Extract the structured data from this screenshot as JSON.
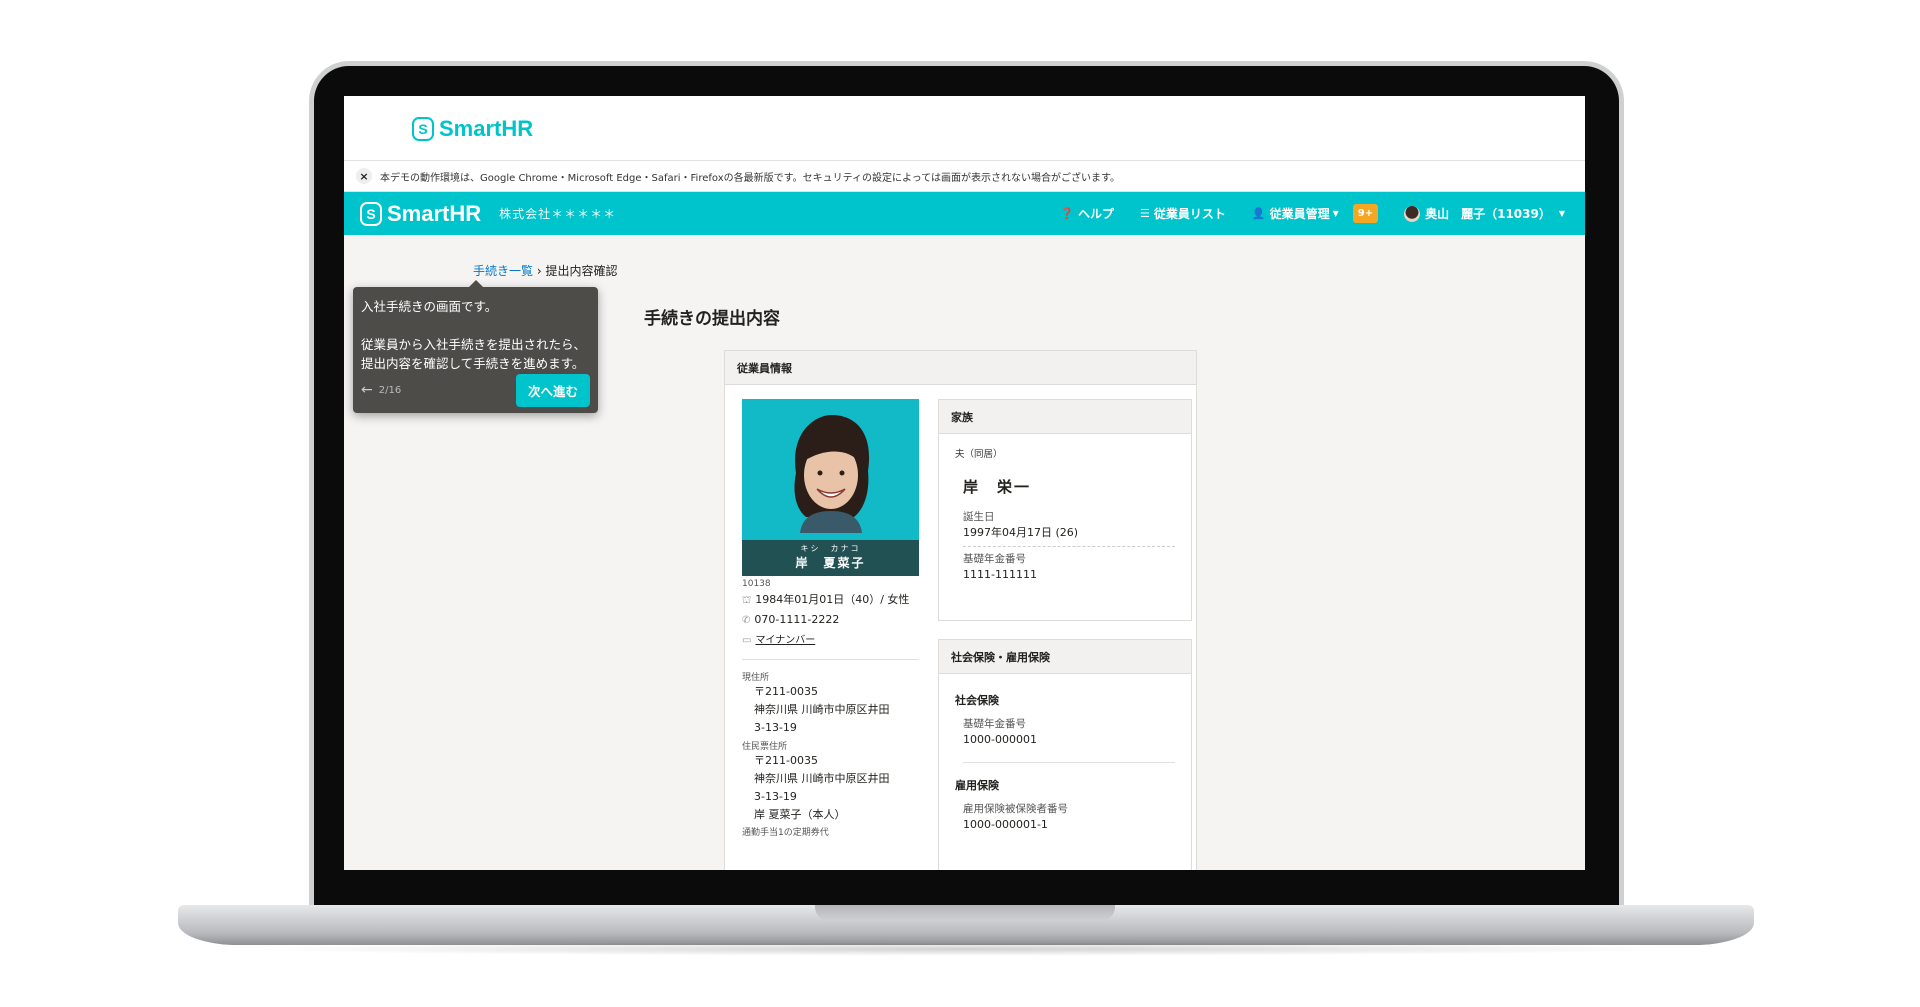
{
  "brand": {
    "name": "SmartHR",
    "mark": "S"
  },
  "notice": {
    "text": "本デモの動作環境は、Google Chrome・Microsoft Edge・Safari・Firefoxの各最新版です。セキュリティの設定によっては画面が表示されない場合がございます。"
  },
  "nav": {
    "company": "株式会社＊＊＊＊＊",
    "help": "ヘルプ",
    "employee_list": "従業員リスト",
    "employee_manage": "従業員管理",
    "badge": "9+",
    "user": "奥山　麗子（11039）"
  },
  "breadcrumb": {
    "link": "手続き一覧",
    "sep": "›",
    "current": "提出内容確認"
  },
  "page_title": "手続きの提出内容",
  "tooltip": {
    "line1": "入社手続きの画面です。",
    "line2": "従業員から入社手続きを提出されたら、提出内容を確認して手続きを進めます。",
    "step": "2/16",
    "next": "次へ進む"
  },
  "employee": {
    "section_title": "従業員情報",
    "kana": "キシ　カナコ",
    "name": "岸　夏菜子",
    "id": "10138",
    "birth": "1984年01月01日（40）/ 女性",
    "phone": "070-1111-2222",
    "mynumber": "マイナンバー",
    "address_label": "現住所",
    "address_zip": "〒211-0035",
    "address_line1": "神奈川県 川崎市中原区井田",
    "address_line2": "3-13-19",
    "resident_label": "住民票住所",
    "resident_zip": "〒211-0035",
    "resident_line1": "神奈川県 川崎市中原区井田",
    "resident_line2": "3-13-19",
    "resident_holder": "岸 夏菜子（本人）",
    "commute": "通勤手当1の定期券代"
  },
  "family": {
    "title": "家族",
    "relation": "夫（同居）",
    "name": "岸　栄一",
    "birth_label": "誕生日",
    "birth_value": "1997年04月17日 (26)",
    "pension_label": "基礎年金番号",
    "pension_value": "1111-111111"
  },
  "insurance": {
    "title": "社会保険・雇用保険",
    "social_title": "社会保険",
    "pension_label": "基礎年金番号",
    "pension_value": "1000-000001",
    "employment_title": "雇用保険",
    "employment_label": "雇用保険被保険者番号",
    "employment_value": "1000-000001-1"
  },
  "colors": {
    "brand": "#00c4cc",
    "badge": "#f5a623",
    "link": "#0077c7"
  }
}
